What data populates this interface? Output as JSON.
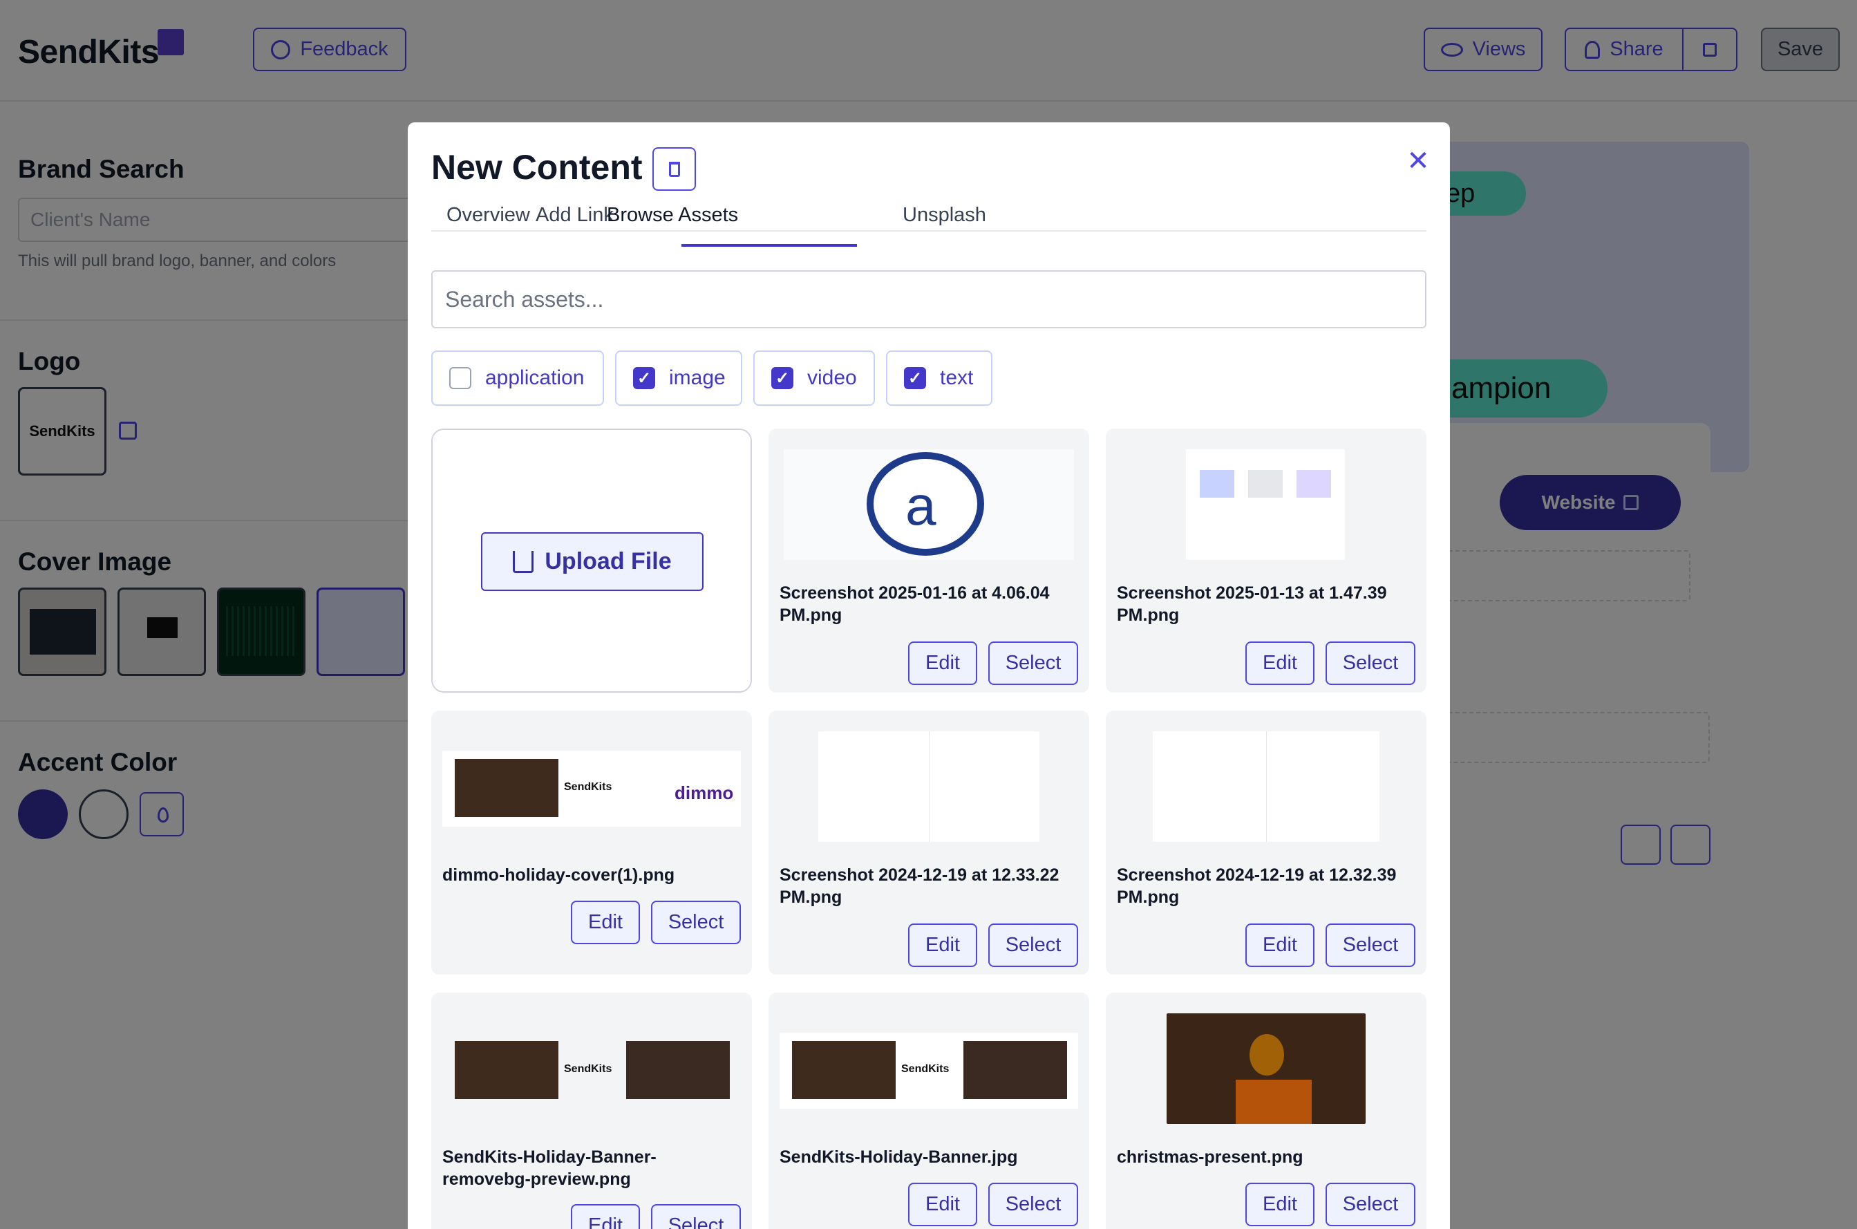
{
  "header": {
    "brand": "SendKits",
    "feedback_label": "Feedback",
    "views_label": "Views",
    "share_label": "Share",
    "save_label": "Save"
  },
  "left": {
    "brand_search_title": "Brand Search",
    "client_placeholder": "Client's Name",
    "brand_hint": "This will pull brand logo, banner, and colors",
    "logo_title": "Logo",
    "logo_text": "SendKits",
    "cover_title": "Cover Image",
    "accent_title": "Accent Color",
    "accent_color": "#3730a3"
  },
  "preview": {
    "pill_top": "ep",
    "pill_bottom": "ampion",
    "website_label": "Website"
  },
  "modal": {
    "title": "New Content",
    "tabs": [
      "Overview",
      "Add Link",
      "Browse Assets",
      "Unsplash"
    ],
    "active_tab": "Browse Assets",
    "search_placeholder": "Search assets...",
    "filters": [
      {
        "label": "application",
        "checked": false
      },
      {
        "label": "image",
        "checked": true
      },
      {
        "label": "video",
        "checked": true
      },
      {
        "label": "text",
        "checked": true
      }
    ],
    "upload_label": "Upload File",
    "edit_label": "Edit",
    "select_label": "Select",
    "assets": [
      {
        "name": "Screenshot 2025-01-16 at 4.06.04 PM.png"
      },
      {
        "name": "Screenshot 2025-01-13 at 1.47.39 PM.png"
      },
      {
        "name": "dimmo-holiday-cover(1).png"
      },
      {
        "name": "Screenshot 2024-12-19 at 12.33.22 PM.png"
      },
      {
        "name": "Screenshot 2024-12-19 at 12.32.39 PM.png"
      },
      {
        "name": "SendKits-Holiday-Banner-removebg-preview.png"
      },
      {
        "name": "SendKits-Holiday-Banner.jpg"
      },
      {
        "name": "christmas-present.png"
      }
    ]
  },
  "colors": {
    "accent": "#4338ca",
    "teal": "#5eead4"
  }
}
